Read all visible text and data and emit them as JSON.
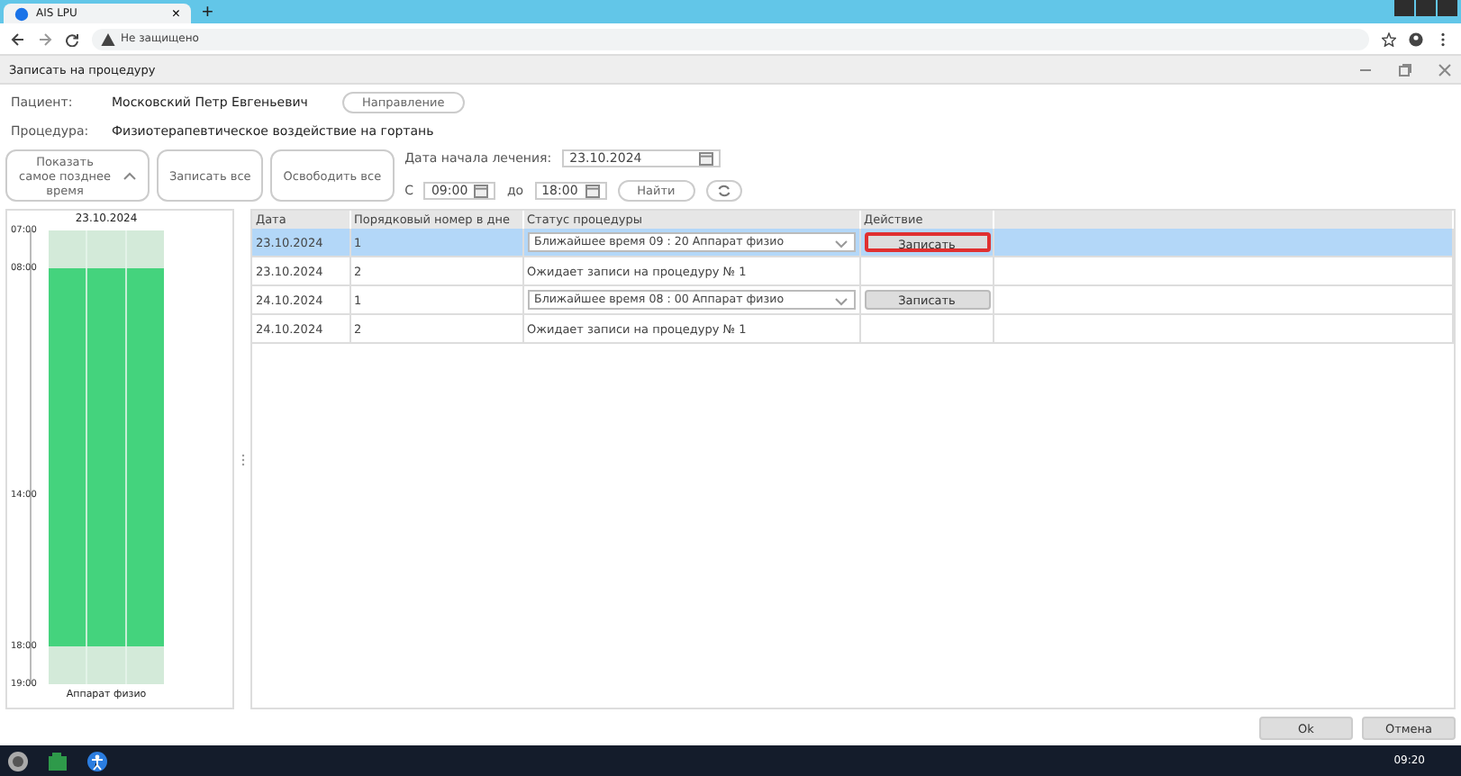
{
  "browser": {
    "tab_title": "AIS LPU",
    "tab_close": "×",
    "new_tab": "+",
    "security": "Не защищено"
  },
  "window": {
    "title": "Записать на процедуру"
  },
  "patient": {
    "label": "Пациент:",
    "value": "Московский Петр Евгеньевич",
    "button": "Направление"
  },
  "procedure": {
    "label": "Процедура:",
    "value": "Физиотерапевтическое воздействие на гортань"
  },
  "toolbar": {
    "show_latest": "Показать самое позднее время",
    "record_all": "Записать все",
    "release_all": "Освободить все",
    "start_label": "Дата начала лечения:",
    "start_date": "23.10.2024",
    "from_label": "С",
    "from_time": "09:00",
    "to_label": "до",
    "to_time": "18:00",
    "find": "Найти"
  },
  "schedule": {
    "date": "23.10.2024",
    "times": [
      "07:00",
      "08:00",
      "14:00",
      "18:00",
      "19:00"
    ],
    "resource": "Аппарат физио"
  },
  "table": {
    "columns": [
      "Дата",
      "Порядковый номер в дне",
      "Статус процедуры",
      "Действие"
    ],
    "rows": [
      {
        "date": "23.10.2024",
        "number": "1",
        "status": {
          "kind": "dropdown",
          "text": "Ближайшее время 09 : 20 Аппарат физио"
        },
        "action": {
          "label": "Записать",
          "focused": true
        },
        "selected": true
      },
      {
        "date": "23.10.2024",
        "number": "2",
        "status": {
          "kind": "text",
          "text": "Ожидает записи на процедуру № 1"
        },
        "selected": false
      },
      {
        "date": "24.10.2024",
        "number": "1",
        "status": {
          "kind": "dropdown",
          "text": "Ближайшее время 08 : 00 Аппарат физио"
        },
        "action": {
          "label": "Записать",
          "focused": false
        },
        "selected": false
      },
      {
        "date": "24.10.2024",
        "number": "2",
        "status": {
          "kind": "text",
          "text": "Ожидает записи на процедуру № 1"
        },
        "selected": false
      }
    ]
  },
  "buttons": [
    "Ok",
    "Отмена"
  ],
  "taskbar": {
    "time": "09:20"
  }
}
